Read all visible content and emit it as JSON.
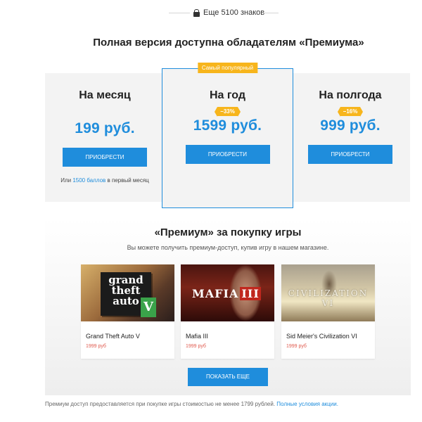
{
  "top_notice": {
    "text": "Еще 5100 знаков",
    "icon": "lock-icon"
  },
  "heading": "Полная версия доступна обладателям «Премиума»",
  "plans": [
    {
      "title": "На месяц",
      "price": "199 руб.",
      "discount": "",
      "button": "Приобрести",
      "points_prefix": "Или ",
      "points_link": "1500 баллов",
      "points_suffix": " в первый месяц"
    },
    {
      "title": "На год",
      "price": "1599 руб.",
      "discount": "−33%",
      "button": "Приобрести",
      "badge": "Самый популярный"
    },
    {
      "title": "На полгода",
      "price": "999 руб.",
      "discount": "−16%",
      "button": "Приобрести"
    }
  ],
  "games_section": {
    "title": "«Премиум» за покупку игры",
    "subtitle": "Вы можете получить премиум-доступ, купив игру в нашем магазине.",
    "games": [
      {
        "name": "Grand Theft Auto V",
        "price": "1999 руб"
      },
      {
        "name": "Mafia III",
        "price": "1999 руб"
      },
      {
        "name": "Sid Meier's Civilization VI",
        "price": "1999 руб"
      }
    ],
    "show_more": "Показать еще"
  },
  "footnote": {
    "text": "Премиум доступ предоставляется при покупке игры стоимостью не менее 1799 рублей. ",
    "link": "Полные условия акции."
  },
  "colors": {
    "accent": "#1f8ddc",
    "badge": "#f7b51c",
    "price_red": "#e05a4e"
  }
}
